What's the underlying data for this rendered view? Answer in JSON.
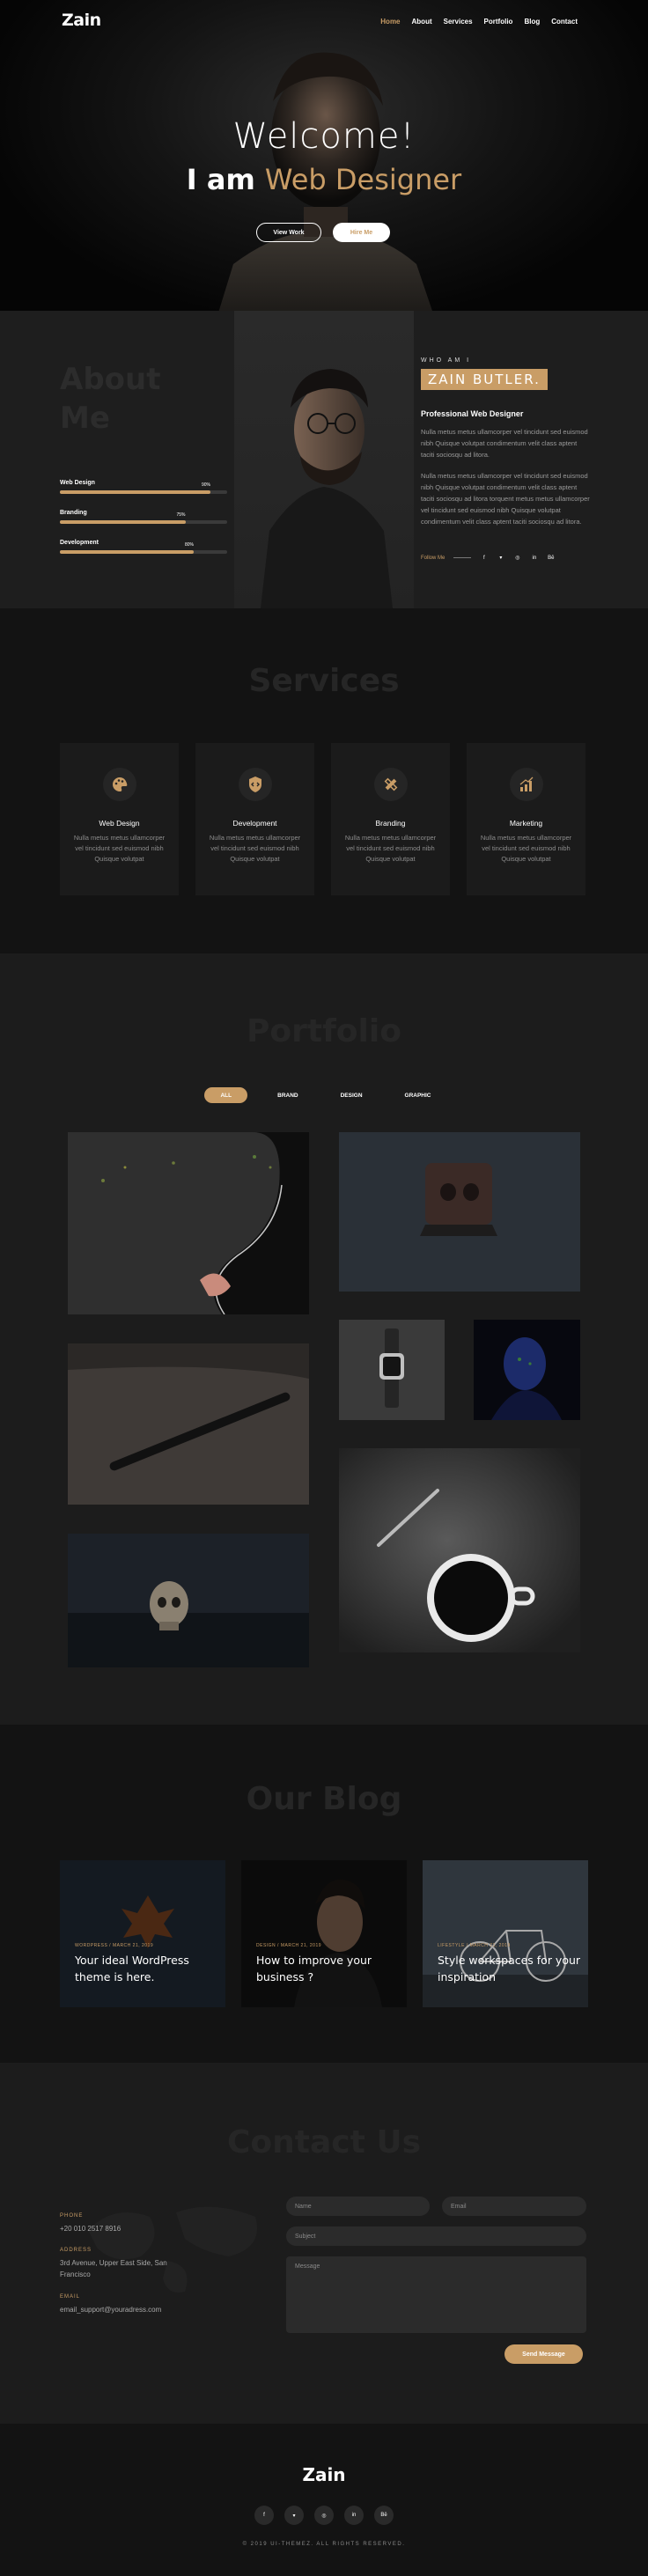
{
  "nav": {
    "logo": "Zain",
    "links": [
      "Home",
      "About",
      "Services",
      "Portfolio",
      "Blog",
      "Contact"
    ],
    "active": "Home"
  },
  "hero": {
    "welcome": "Welcome!",
    "lead": "I am",
    "role": "Web Designer",
    "primary_button": "View Work",
    "secondary_button": "Hire Me"
  },
  "about": {
    "title_line1": "About",
    "title_line2": "Me",
    "skills": [
      {
        "label": "Web Design",
        "value_text": "90%",
        "value": 0.9
      },
      {
        "label": "Branding",
        "value_text": "75%",
        "value": 0.75
      },
      {
        "label": "Development",
        "value_text": "80%",
        "value": 0.8
      }
    ],
    "who": "WHO AM I",
    "name": "ZAIN BUTLER.",
    "role": "Professional Web Designer",
    "para1": "Nulla metus metus ullamcorper vel tincidunt sed euismod nibh Quisque volutpat condimentum velit class aptent taciti sociosqu ad litora.",
    "para2": "Nulla metus metus ullamcorper vel tincidunt sed euismod nibh Quisque volutpat condimentum velit class aptent taciti sociosqu ad litora torquent metus metus ullamcorper vel tincidunt sed euismod nibh Quisque volutpat condimentum velit class aptent taciti sociosqu ad litora.",
    "follow": "Follow Me",
    "social_icons": [
      "facebook-icon",
      "twitter-icon",
      "instagram-icon",
      "linkedin-icon",
      "behance-icon"
    ]
  },
  "services": {
    "title": "Services",
    "items": [
      {
        "title": "Web Design",
        "text": "Nulla metus metus ullamcorper vel tincidunt sed euismod nibh Quisque volutpat",
        "icon": "palette-icon"
      },
      {
        "title": "Development",
        "text": "Nulla metus metus ullamcorper vel tincidunt sed euismod nibh Quisque volutpat",
        "icon": "shield-code-icon"
      },
      {
        "title": "Branding",
        "text": "Nulla metus metus ullamcorper vel tincidunt sed euismod nibh Quisque volutpat",
        "icon": "pen-ruler-icon"
      },
      {
        "title": "Marketing",
        "text": "Nulla metus metus ullamcorper vel tincidunt sed euismod nibh Quisque volutpat",
        "icon": "growth-chart-icon"
      }
    ]
  },
  "portfolio": {
    "title": "Portfolio",
    "filters": [
      "ALL",
      "BRAND",
      "DESIGN",
      "GRAPHIC"
    ],
    "active_filter": "ALL"
  },
  "blog": {
    "title": "Our Blog",
    "posts": [
      {
        "meta": "WORDPRESS  /  MARCH 21, 2019",
        "title": "Your ideal WordPress theme is here."
      },
      {
        "meta": "DESIGN  /  MARCH 21, 2019",
        "title": "How to improve your business ?"
      },
      {
        "meta": "LIFESTYLE  /  MARCH 21, 2019",
        "title": "Style workspaces for your inspiration"
      }
    ]
  },
  "contact": {
    "title": "Contact Us",
    "phone_label": "PHONE",
    "phone": "+20 010 2517 8916",
    "address_label": "ADDRESS",
    "address": "3rd Avenue, Upper East Side, San Francisco",
    "email_label": "EMAIL",
    "email": "email_support@youradress.com",
    "name_placeholder": "Name",
    "email_placeholder": "Email",
    "subject_placeholder": "Subject",
    "message_placeholder": "Message",
    "send": "Send Message"
  },
  "footer": {
    "logo": "Zain",
    "social_icons": [
      "facebook-icon",
      "twitter-icon",
      "instagram-icon",
      "linkedin-icon",
      "behance-icon"
    ],
    "copyright": "© 2019 UI-THEMEZ. ALL RIGHTS RESERVED."
  },
  "colors": {
    "accent": "#c99d66",
    "dark": "#131313",
    "panel": "#1c1c1c"
  }
}
